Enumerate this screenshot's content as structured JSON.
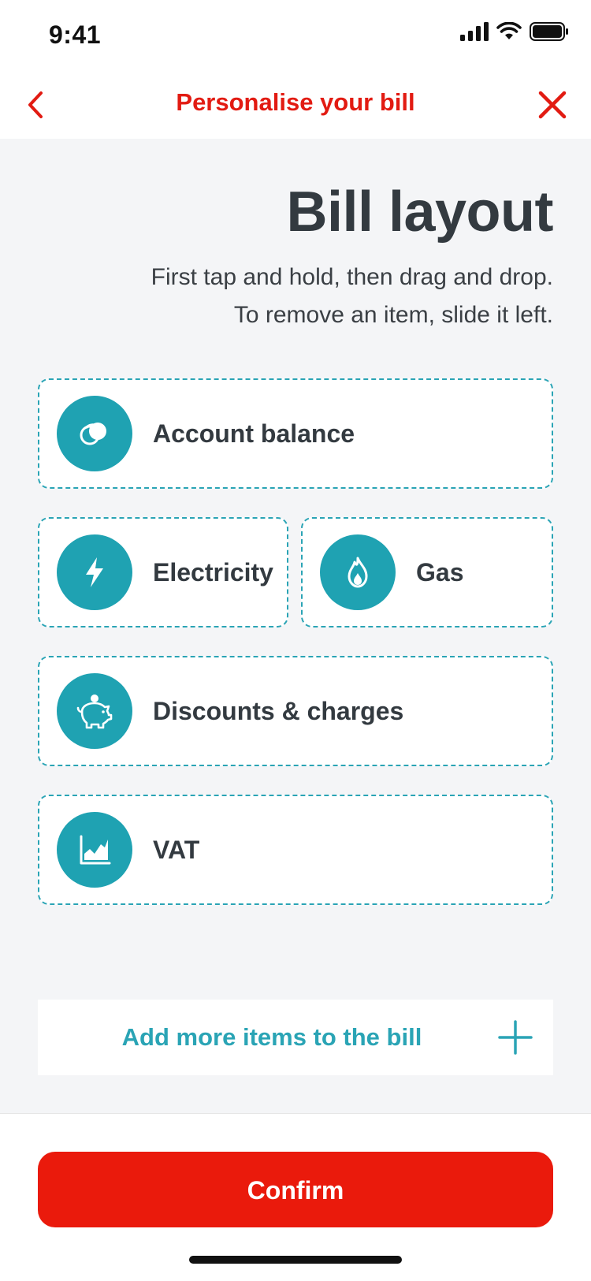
{
  "status_bar": {
    "time": "9:41"
  },
  "nav": {
    "title": "Personalise your bill"
  },
  "page": {
    "title": "Bill layout",
    "instruction_line1": "First tap and hold, then drag and drop.",
    "instruction_line2": "To remove an item, slide it left."
  },
  "items": [
    {
      "label": "Account balance",
      "icon": "coins-icon"
    },
    {
      "label": "Electricity",
      "icon": "lightning-icon"
    },
    {
      "label": "Gas",
      "icon": "flame-icon"
    },
    {
      "label": "Discounts & charges",
      "icon": "piggy-bank-icon"
    },
    {
      "label": "VAT",
      "icon": "area-chart-icon"
    }
  ],
  "add_more": {
    "label": "Add more items to the bill"
  },
  "footer": {
    "confirm_label": "Confirm"
  },
  "colors": {
    "accent_red": "#e21b12",
    "confirm_red": "#ea1a0c",
    "teal": "#1fa2b2",
    "title_dark": "#333a40"
  }
}
